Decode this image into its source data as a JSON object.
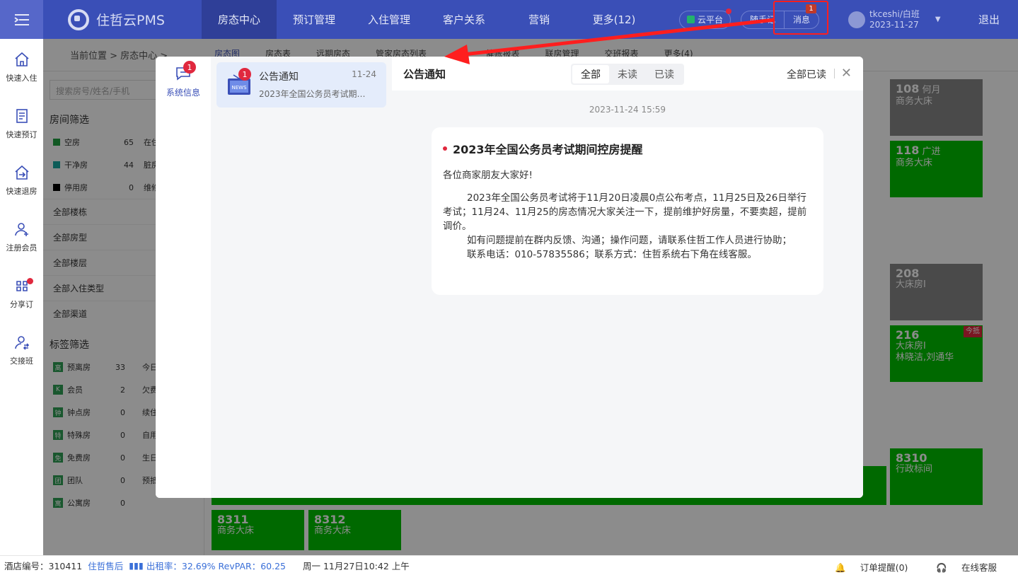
{
  "topbar": {
    "logo_text": "住哲云PMS",
    "nav": [
      "房态中心",
      "预订管理",
      "入住管理",
      "客户关系",
      "营销",
      "更多(12)"
    ],
    "cloud_label": "云平台",
    "notes_label": "随手记",
    "message_label": "消息",
    "message_count": "1",
    "user_name": "tkceshi/白班",
    "user_date": "2023-11-27",
    "logout_label": "退出"
  },
  "rail": [
    {
      "label": "快速入住",
      "icon": "home-icon"
    },
    {
      "label": "快速预订",
      "icon": "document-icon"
    },
    {
      "label": "快速退房",
      "icon": "checkout-icon"
    },
    {
      "label": "注册会员",
      "icon": "add-user-icon"
    },
    {
      "label": "分享订",
      "icon": "share-icon"
    },
    {
      "label": "交接班",
      "icon": "handover-icon"
    }
  ],
  "background": {
    "breadcrumb": "当前位置 > 房态中心 >",
    "subtabs": [
      "房态图",
      "房态表",
      "远期房态",
      "管家房态列表",
      "...",
      "催账报表",
      "联房管理",
      "交班报表",
      "更多(4)"
    ],
    "search_placeholder": "搜索房号/姓名/手机",
    "room_filter_title": "房间筛选",
    "stats": [
      {
        "label": "空房",
        "count": "65",
        "color": "#20a040"
      },
      {
        "label": "干净房",
        "count": "44",
        "color": "#18a8a0"
      },
      {
        "label": "停用房",
        "count": "0",
        "color": "#000000"
      }
    ],
    "stats_right": [
      "在住",
      "脏房",
      "维修"
    ],
    "dropdowns": [
      "全部楼栋",
      "全部房型",
      "全部楼层",
      "全部入住类型",
      "全部渠道"
    ],
    "tag_filter_title": "标签筛选",
    "tags": [
      {
        "label": "预离房",
        "count": "33",
        "glyph": "离"
      },
      {
        "label": "会员",
        "count": "2",
        "glyph": "K"
      },
      {
        "label": "钟点房",
        "count": "0",
        "glyph": "钟"
      },
      {
        "label": "特殊房",
        "count": "0",
        "glyph": "特"
      },
      {
        "label": "免费房",
        "count": "0",
        "glyph": "免"
      },
      {
        "label": "团队",
        "count": "0",
        "glyph": "团"
      },
      {
        "label": "公寓房",
        "count": "0",
        "glyph": "寓"
      }
    ],
    "tags_right": [
      "今日",
      "欠费",
      "续住",
      "自用",
      "生日",
      "预抵"
    ],
    "rooms": [
      {
        "no": "108",
        "name": "何月",
        "type": "商务大床",
        "color": "gray"
      },
      {
        "no": "118",
        "name": "广进",
        "type": "商务大床",
        "color": "green"
      },
      {
        "no": "208",
        "name": "",
        "type": "大床房Ⅰ",
        "color": "gray"
      },
      {
        "no": "216",
        "name": "",
        "type": "大床房Ⅰ",
        "guests": "林晓洁,刘通华",
        "tag": "今抵",
        "color": "green"
      },
      {
        "no": "8310",
        "name": "",
        "type": "行政标间",
        "color": "green"
      },
      {
        "no": "8311",
        "name": "",
        "type": "商务大床",
        "color": "green"
      },
      {
        "no": "8312",
        "name": "",
        "type": "商务大床",
        "color": "green"
      }
    ]
  },
  "modal": {
    "nav_label": "系统信息",
    "nav_badge": "1",
    "list_item": {
      "title": "公告通知",
      "date": "11-24",
      "preview": "2023年全国公务员考试期间控房提醒",
      "badge": "1",
      "icon_text": "NEWS"
    },
    "header_title": "公告通知",
    "filters": [
      "全部",
      "未读",
      "已读"
    ],
    "read_all": "全部已读",
    "timestamp": "2023-11-24 15:59",
    "message": {
      "title": "2023年全国公务员考试期间控房提醒",
      "greeting": "各位商家朋友大家好!",
      "para1": "2023年全国公务员考试将于11月20日凌晨0点公布考点，11月25日及26日举行考试；11月24、11月25的房态情况大家关注一下，提前维护好房量，不要卖超，提前调价。",
      "para2": "如有问题提前在群内反馈、沟通；操作问题，请联系住哲工作人员进行协助；",
      "para3": "联系电话：010-57835586；联系方式：住哲系统右下角在线客服。"
    }
  },
  "statusbar": {
    "hotel_label": "酒店编号：310411",
    "after_sales": "住哲售后",
    "occupancy": "出租率：32.69% RevPAR：60.25",
    "datetime": "周一 11月27日10:42 上午",
    "order_alert": "订单提醒(0)",
    "online_service": "在线客服"
  }
}
